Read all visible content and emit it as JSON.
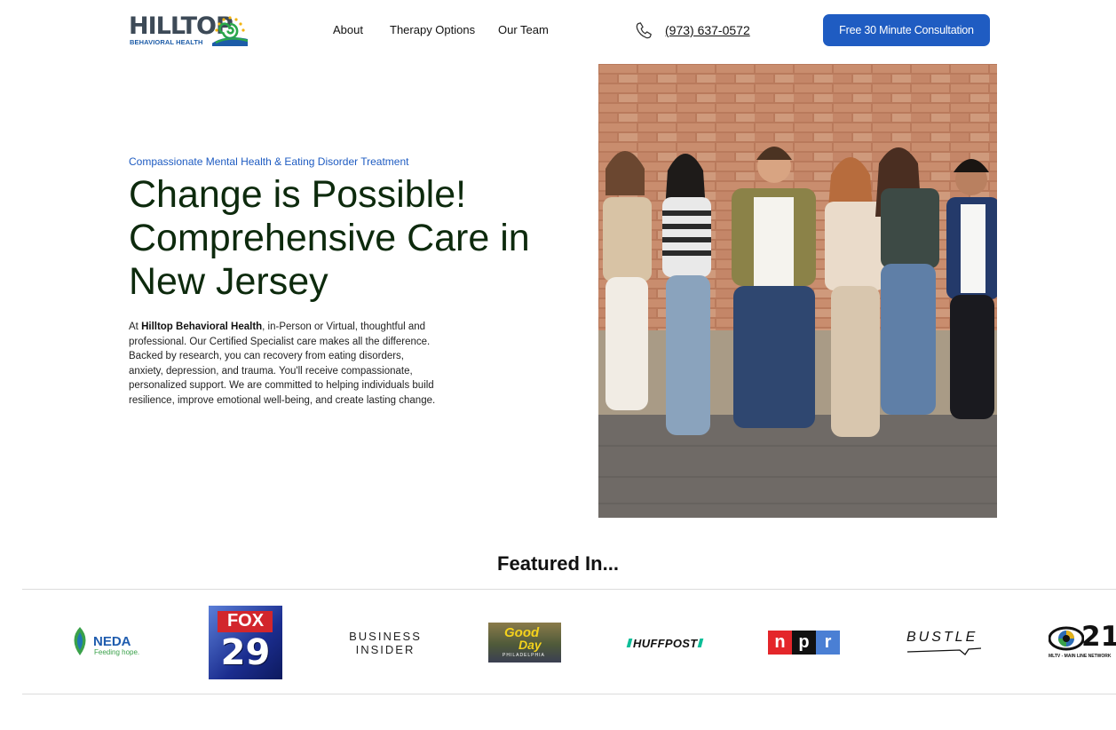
{
  "header": {
    "logo_text": "HILLTOP",
    "logo_subtext": "BEHAVIORAL HEALTH",
    "nav": [
      {
        "label": "About"
      },
      {
        "label": "Therapy Options"
      },
      {
        "label": "Our Team"
      }
    ],
    "phone": "(973) 637-0572",
    "cta_label": "Free 30 Minute Consultation"
  },
  "hero": {
    "eyebrow": "Compassionate Mental Health & Eating Disorder Treatment",
    "headline": "Change is Possible! Comprehensive Care in New Jersey",
    "body_prefix": "At ",
    "body_brand": "Hilltop Behavioral Health",
    "body_rest": ", in-Person or Virtual, thoughtful and professional. Our Certified Specialist care makes all the difference. Backed by research, you can recovery from eating disorders, anxiety, depression, and trauma. You'll receive compassionate, personalized support. We are committed to helping individuals build resilience, improve emotional well-being, and create lasting change."
  },
  "featured": {
    "title": "Featured In...",
    "logos": {
      "neda": {
        "name": "NEDA",
        "tagline": "Feeding hope."
      },
      "fox": {
        "top": "FOX",
        "number": "29"
      },
      "business_insider": {
        "line1": "BUSINESS",
        "line2": "INSIDER"
      },
      "good_day": {
        "line1": "Good",
        "line2": "Day",
        "line3": "PHILADELPHIA"
      },
      "huffpost": {
        "name": "HUFFPOST"
      },
      "npr": {
        "letters": [
          "n",
          "p",
          "r"
        ]
      },
      "bustle": {
        "name": "BUSTLE"
      },
      "mltv": {
        "number": "21",
        "caption": "MLTV - MAIN LINE NETWORK"
      }
    }
  },
  "colors": {
    "accent_blue": "#1f5cc2",
    "headline_green": "#0d2a0d"
  }
}
